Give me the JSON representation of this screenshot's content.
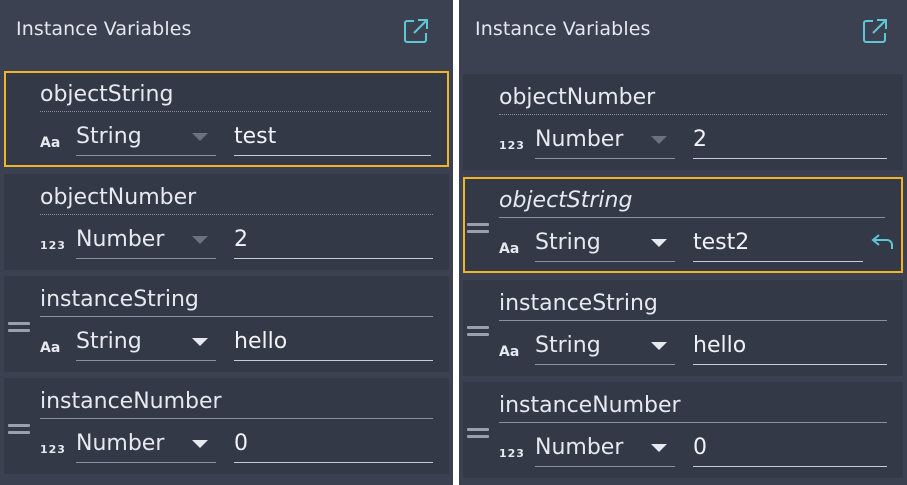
{
  "left_panel": {
    "title": "Instance Variables",
    "rows": [
      {
        "name": "objectString",
        "type_icon": "Aa",
        "type": "String",
        "value": "test"
      },
      {
        "name": "objectNumber",
        "type_icon": "123",
        "type": "Number",
        "value": "2"
      },
      {
        "name": "instanceString",
        "type_icon": "Aa",
        "type": "String",
        "value": "hello"
      },
      {
        "name": "instanceNumber",
        "type_icon": "123",
        "type": "Number",
        "value": "0"
      }
    ]
  },
  "right_panel": {
    "title": "Instance Variables",
    "rows": [
      {
        "name": "objectNumber",
        "type_icon": "123",
        "type": "Number",
        "value": "2"
      },
      {
        "name": "objectString",
        "type_icon": "Aa",
        "type": "String",
        "value": "test2"
      },
      {
        "name": "instanceString",
        "type_icon": "Aa",
        "type": "String",
        "value": "hello"
      },
      {
        "name": "instanceNumber",
        "type_icon": "123",
        "type": "Number",
        "value": "0"
      }
    ]
  },
  "colors": {
    "panel_bg": "#3b4150",
    "row_bg": "#333947",
    "highlight_border": "#f0b429",
    "accent_icon": "#5fc6d6",
    "text": "#e6e9ef"
  },
  "icons": {
    "popout": "external-link-icon",
    "drag": "drag-handle-icon",
    "revert": "undo-arrow-icon",
    "dropdown": "chevron-down-icon"
  }
}
